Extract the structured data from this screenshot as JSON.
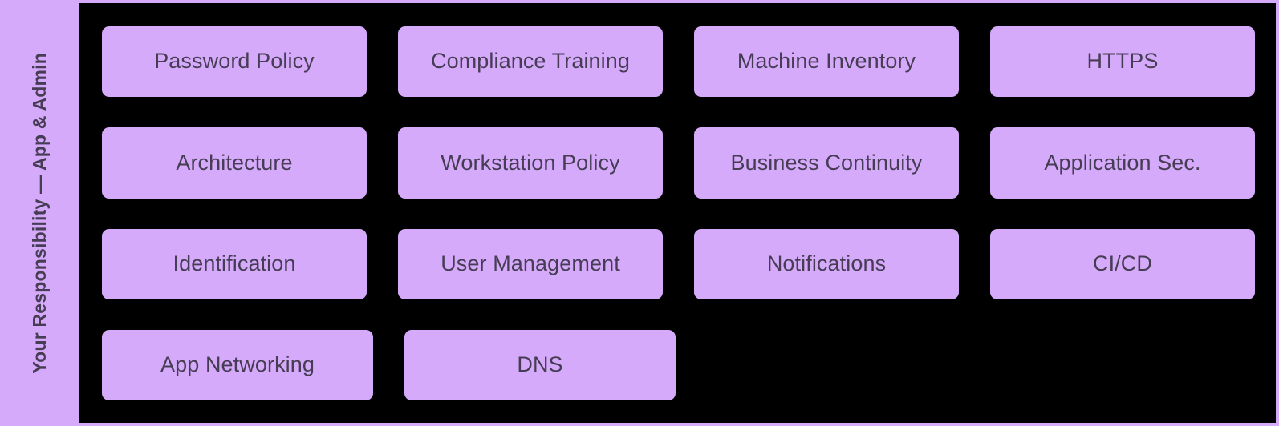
{
  "colors": {
    "panel_background": "#000000",
    "card_fill": "#D6AAFA",
    "card_text": "#463D55",
    "sidebar_fill": "#D6AAFA",
    "border": "#D6AAFA"
  },
  "sidebar": {
    "label": "Your Responsibility — App & Admin"
  },
  "matrix": {
    "rows": [
      {
        "cards": [
          {
            "label": "Password Policy"
          },
          {
            "label": "Compliance Training"
          },
          {
            "label": "Machine Inventory"
          },
          {
            "label": "HTTPS"
          }
        ]
      },
      {
        "cards": [
          {
            "label": "Architecture"
          },
          {
            "label": "Workstation Policy"
          },
          {
            "label": "Business Continuity"
          },
          {
            "label": "Application Sec."
          }
        ]
      },
      {
        "cards": [
          {
            "label": "Identification"
          },
          {
            "label": "User Management"
          },
          {
            "label": "Notifications"
          },
          {
            "label": "CI/CD"
          }
        ]
      },
      {
        "cards": [
          {
            "label": "App Networking"
          },
          {
            "label": "DNS"
          }
        ]
      }
    ]
  }
}
